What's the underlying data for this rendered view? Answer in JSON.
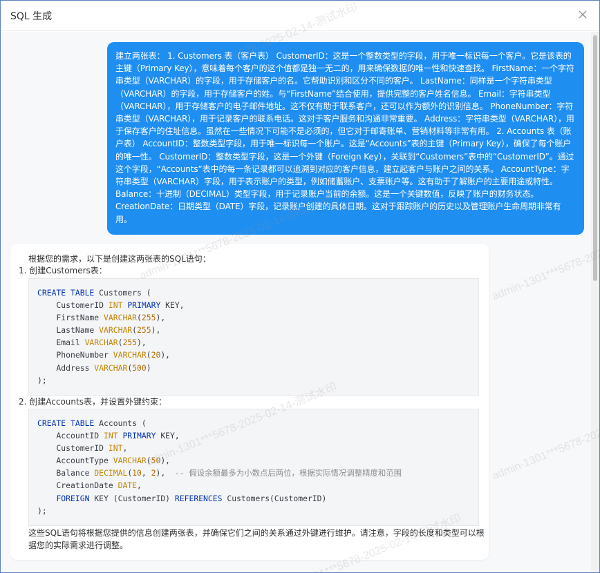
{
  "dialog": {
    "title": "SQL 生成"
  },
  "user_message": {
    "text": "建立两张表： 1. Customers 表（客户表） CustomerID：这是一个整数类型的字段，用于唯一标识每一个客户。它是该表的主键（Primary Key），意味着每个客户的这个值都是独一无二的，用来确保数据的唯一性和快速查找。 FirstName：一个字符串类型（VARCHAR）的字段，用于存储客户的名。它帮助识别和区分不同的客户。 LastName：同样是一个字符串类型（VARCHAR）的字段，用于存储客户的姓。与“FirstName”结合使用，提供完整的客户姓名信息。 Email：字符串类型（VARCHAR），用于存储客户的电子邮件地址。这不仅有助于联系客户，还可以作为额外的识别信息。 PhoneNumber：字符串类型（VARCHAR），用于记录客户的联系电话。这对于客户服务和沟通非常重要。 Address：字符串类型（VARCHAR），用于保存客户的住址信息。虽然在一些情况下可能不是必须的，但它对于邮寄账单、营销材料等非常有用。 2. Accounts 表（账户表） AccountID：整数类型字段，用于唯一标识每一个账户。这是“Accounts”表的主键（Primary Key），确保了每个账户的唯一性。 CustomerID：整数类型字段，这是一个外键（Foreign Key），关联到“Customers”表中的“CustomerID”。通过这个字段，“Accounts”表中的每一条记录都可以追溯到对应的客户信息，建立起客户与账户之间的关系。 AccountType：字符串类型（VARCHAR）字段，用于表示账户的类型，例如储蓄账户、支票账户等。这有助于了解账户的主要用途或特性。 Balance：十进制（DECIMAL）类型字段，用于记录账户当前的余额。这是一个关键数值，反映了账户的财务状态。 CreationDate：日期类型（DATE）字段，记录账户创建的具体日期。这对于跟踪账户的历史以及管理账户生命周期非常有用。"
  },
  "ai_response": {
    "intro": "根据您的需求，以下是创建这两张表的SQL语句：",
    "step1": "1. 创建Customers表：",
    "code1": [
      [
        {
          "t": "CREATE TABLE",
          "c": "kw"
        },
        {
          "t": " Customers (",
          "c": ""
        }
      ],
      [
        {
          "t": "    CustomerID ",
          "c": ""
        },
        {
          "t": "INT",
          "c": "ty"
        },
        {
          "t": " ",
          "c": ""
        },
        {
          "t": "PRIMARY",
          "c": "kw"
        },
        {
          "t": " KEY,",
          "c": ""
        }
      ],
      [
        {
          "t": "    FirstName ",
          "c": ""
        },
        {
          "t": "VARCHAR",
          "c": "ty"
        },
        {
          "t": "(",
          "c": ""
        },
        {
          "t": "255",
          "c": "nu"
        },
        {
          "t": "),",
          "c": ""
        }
      ],
      [
        {
          "t": "    LastName ",
          "c": ""
        },
        {
          "t": "VARCHAR",
          "c": "ty"
        },
        {
          "t": "(",
          "c": ""
        },
        {
          "t": "255",
          "c": "nu"
        },
        {
          "t": "),",
          "c": ""
        }
      ],
      [
        {
          "t": "    Email ",
          "c": ""
        },
        {
          "t": "VARCHAR",
          "c": "ty"
        },
        {
          "t": "(",
          "c": ""
        },
        {
          "t": "255",
          "c": "nu"
        },
        {
          "t": "),",
          "c": ""
        }
      ],
      [
        {
          "t": "    PhoneNumber ",
          "c": ""
        },
        {
          "t": "VARCHAR",
          "c": "ty"
        },
        {
          "t": "(",
          "c": ""
        },
        {
          "t": "20",
          "c": "nu"
        },
        {
          "t": "),",
          "c": ""
        }
      ],
      [
        {
          "t": "    Address ",
          "c": ""
        },
        {
          "t": "VARCHAR",
          "c": "ty"
        },
        {
          "t": "(",
          "c": ""
        },
        {
          "t": "500",
          "c": "nu"
        },
        {
          "t": ")",
          "c": ""
        }
      ],
      [
        {
          "t": ");",
          "c": ""
        }
      ]
    ],
    "step2": "2. 创建Accounts表，并设置外键约束：",
    "code2": [
      [
        {
          "t": "CREATE TABLE",
          "c": "kw"
        },
        {
          "t": " Accounts (",
          "c": ""
        }
      ],
      [
        {
          "t": "    AccountID ",
          "c": ""
        },
        {
          "t": "INT",
          "c": "ty"
        },
        {
          "t": " ",
          "c": ""
        },
        {
          "t": "PRIMARY",
          "c": "kw"
        },
        {
          "t": " KEY,",
          "c": ""
        }
      ],
      [
        {
          "t": "    CustomerID ",
          "c": ""
        },
        {
          "t": "INT",
          "c": "ty"
        },
        {
          "t": ",",
          "c": ""
        }
      ],
      [
        {
          "t": "    AccountType ",
          "c": ""
        },
        {
          "t": "VARCHAR",
          "c": "ty"
        },
        {
          "t": "(",
          "c": ""
        },
        {
          "t": "50",
          "c": "nu"
        },
        {
          "t": "),",
          "c": ""
        }
      ],
      [
        {
          "t": "    Balance ",
          "c": ""
        },
        {
          "t": "DECIMAL",
          "c": "ty"
        },
        {
          "t": "(",
          "c": ""
        },
        {
          "t": "10",
          "c": "nu"
        },
        {
          "t": ", ",
          "c": ""
        },
        {
          "t": "2",
          "c": "nu"
        },
        {
          "t": "),  ",
          "c": ""
        },
        {
          "t": "-- 假设余额最多为小数点后两位，根据实际情况调整精度和范围",
          "c": "cm"
        }
      ],
      [
        {
          "t": "    CreationDate ",
          "c": ""
        },
        {
          "t": "DATE",
          "c": "ty"
        },
        {
          "t": ",",
          "c": ""
        }
      ],
      [
        {
          "t": "    ",
          "c": ""
        },
        {
          "t": "FOREIGN",
          "c": "kw"
        },
        {
          "t": " KEY (CustomerID) ",
          "c": ""
        },
        {
          "t": "REFERENCES",
          "c": "kw"
        },
        {
          "t": " Customers(CustomerID)",
          "c": ""
        }
      ],
      [
        {
          "t": ");",
          "c": ""
        }
      ]
    ],
    "outro": "这些SQL语句将根据您提供的信息创建两张表，并确保它们之间的关系通过外键进行维护。请注意，字段的长度和类型可以根据您的实际需求进行调整。"
  },
  "watermark": {
    "text": "admin-1301***5678-2025-02-14-测试水印"
  },
  "colors": {
    "user_bubble": "#1f8ef1",
    "dialog_border": "#5a7fbf",
    "code_keyword": "#0033b3",
    "code_type": "#c18401"
  }
}
